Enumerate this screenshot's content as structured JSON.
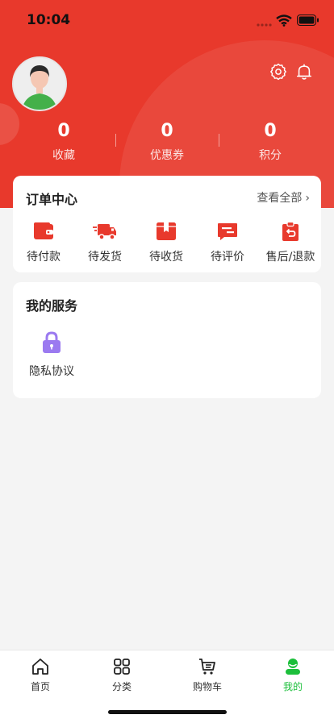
{
  "status": {
    "time": "10:04"
  },
  "colors": {
    "brand_red": "#e8392c",
    "tab_active": "#1cbf3b",
    "privacy_icon": "#9b7af0"
  },
  "stats": [
    {
      "value": "0",
      "label": "收藏"
    },
    {
      "value": "0",
      "label": "优惠券"
    },
    {
      "value": "0",
      "label": "积分"
    }
  ],
  "order_center": {
    "title": "订单中心",
    "view_all": "查看全部",
    "items": [
      {
        "label": "待付款",
        "icon": "wallet-icon"
      },
      {
        "label": "待发货",
        "icon": "truck-icon"
      },
      {
        "label": "待收货",
        "icon": "package-icon"
      },
      {
        "label": "待评价",
        "icon": "comment-icon"
      },
      {
        "label": "售后/退款",
        "icon": "refund-icon"
      }
    ]
  },
  "services": {
    "title": "我的服务",
    "items": [
      {
        "label": "隐私协议",
        "icon": "lock-icon"
      }
    ]
  },
  "tabbar": [
    {
      "label": "首页",
      "icon": "home-icon",
      "active": false
    },
    {
      "label": "分类",
      "icon": "grid-icon",
      "active": false
    },
    {
      "label": "购物车",
      "icon": "cart-icon",
      "active": false
    },
    {
      "label": "我的",
      "icon": "user-icon",
      "active": true
    }
  ]
}
